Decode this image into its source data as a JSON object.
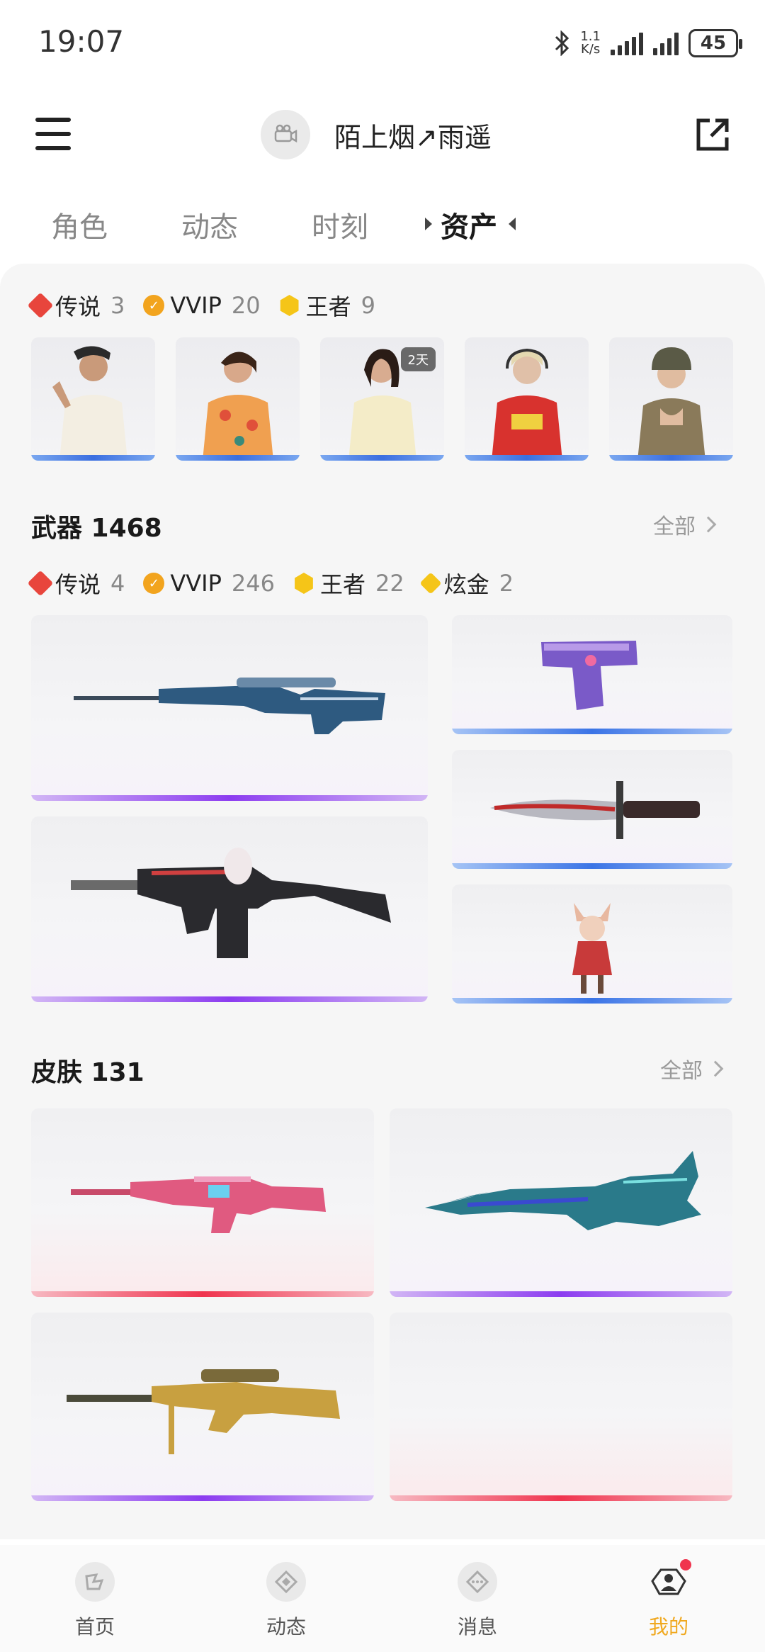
{
  "status_bar": {
    "time": "19:07",
    "net_speed_value": "1.1",
    "net_speed_unit": "K/s",
    "battery": "45"
  },
  "header": {
    "username": "陌上烟↗雨遥"
  },
  "tabs": [
    {
      "label": "角色"
    },
    {
      "label": "动态"
    },
    {
      "label": "时刻"
    },
    {
      "label": "资产"
    }
  ],
  "characters": {
    "rarities": [
      {
        "label": "传说",
        "count": "3"
      },
      {
        "label": "VVIP",
        "count": "20"
      },
      {
        "label": "王者",
        "count": "9"
      }
    ],
    "cards": [
      {
        "name": "character-1"
      },
      {
        "name": "character-2"
      },
      {
        "name": "character-3",
        "tag": "2天"
      },
      {
        "name": "character-4"
      },
      {
        "name": "character-5"
      }
    ]
  },
  "weapons": {
    "title": "武器 1468",
    "see_all": "全部",
    "rarities": [
      {
        "label": "传说",
        "count": "4"
      },
      {
        "label": "VVIP",
        "count": "246"
      },
      {
        "label": "王者",
        "count": "22"
      },
      {
        "label": "炫金",
        "count": "2"
      }
    ]
  },
  "skins": {
    "title": "皮肤 131",
    "see_all": "全部"
  },
  "bottom_nav": [
    {
      "label": "首页",
      "icon": "home-icon"
    },
    {
      "label": "动态",
      "icon": "feed-icon"
    },
    {
      "label": "消息",
      "icon": "message-icon"
    },
    {
      "label": "我的",
      "icon": "profile-icon",
      "active": true
    }
  ],
  "colors": {
    "legend": "#e8453c",
    "vvip": "#f2a41e",
    "king": "#f5c518",
    "gold": "#f5c518",
    "active_nav": "#f0a81e"
  }
}
